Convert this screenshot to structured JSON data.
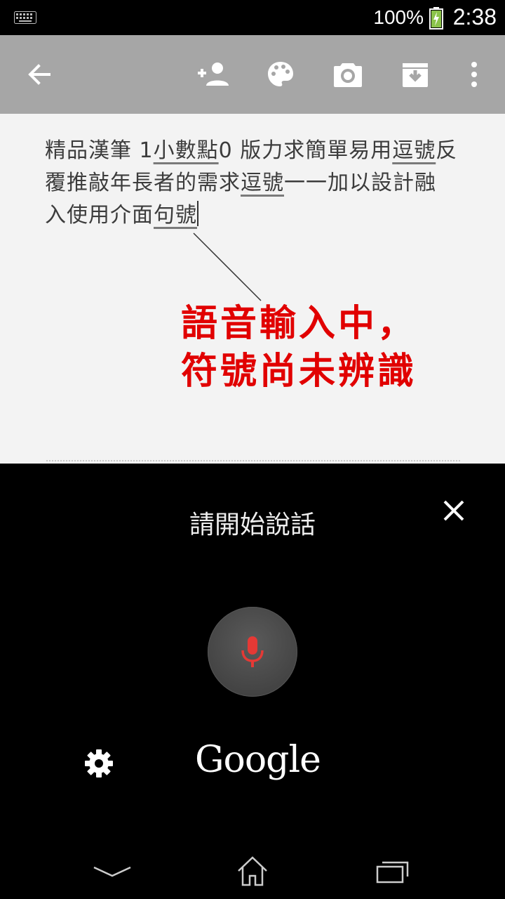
{
  "status_bar": {
    "battery_percent": "100%",
    "time": "2:38",
    "icons": [
      "keyboard-icon",
      "battery-charging-icon"
    ]
  },
  "toolbar": {
    "icons": [
      "back-arrow-icon",
      "add-person-icon",
      "palette-icon",
      "camera-icon",
      "archive-icon",
      "more-vert-icon"
    ]
  },
  "note": {
    "line1": {
      "a": "精品漢筆 1",
      "b": "小數點",
      "c": "0 版力求簡單易用",
      "d": "逗號",
      "e": "反"
    },
    "line2": {
      "a": "覆推敲年長者的需求",
      "b": "逗號",
      "c": "一一加以設計融"
    },
    "line3": {
      "a": "入使用介面",
      "b": "句號"
    }
  },
  "annotation": {
    "line1": "語音輸入中，",
    "line2": "符號尚未辨識"
  },
  "voice_panel": {
    "prompt": "請開始說話",
    "logo": "Google",
    "icons": [
      "close-icon",
      "microphone-icon",
      "gear-icon"
    ],
    "mic_color": "#e53935"
  },
  "nav_bar": {
    "icons": [
      "hide-keyboard-icon",
      "home-icon",
      "recents-icon"
    ]
  }
}
